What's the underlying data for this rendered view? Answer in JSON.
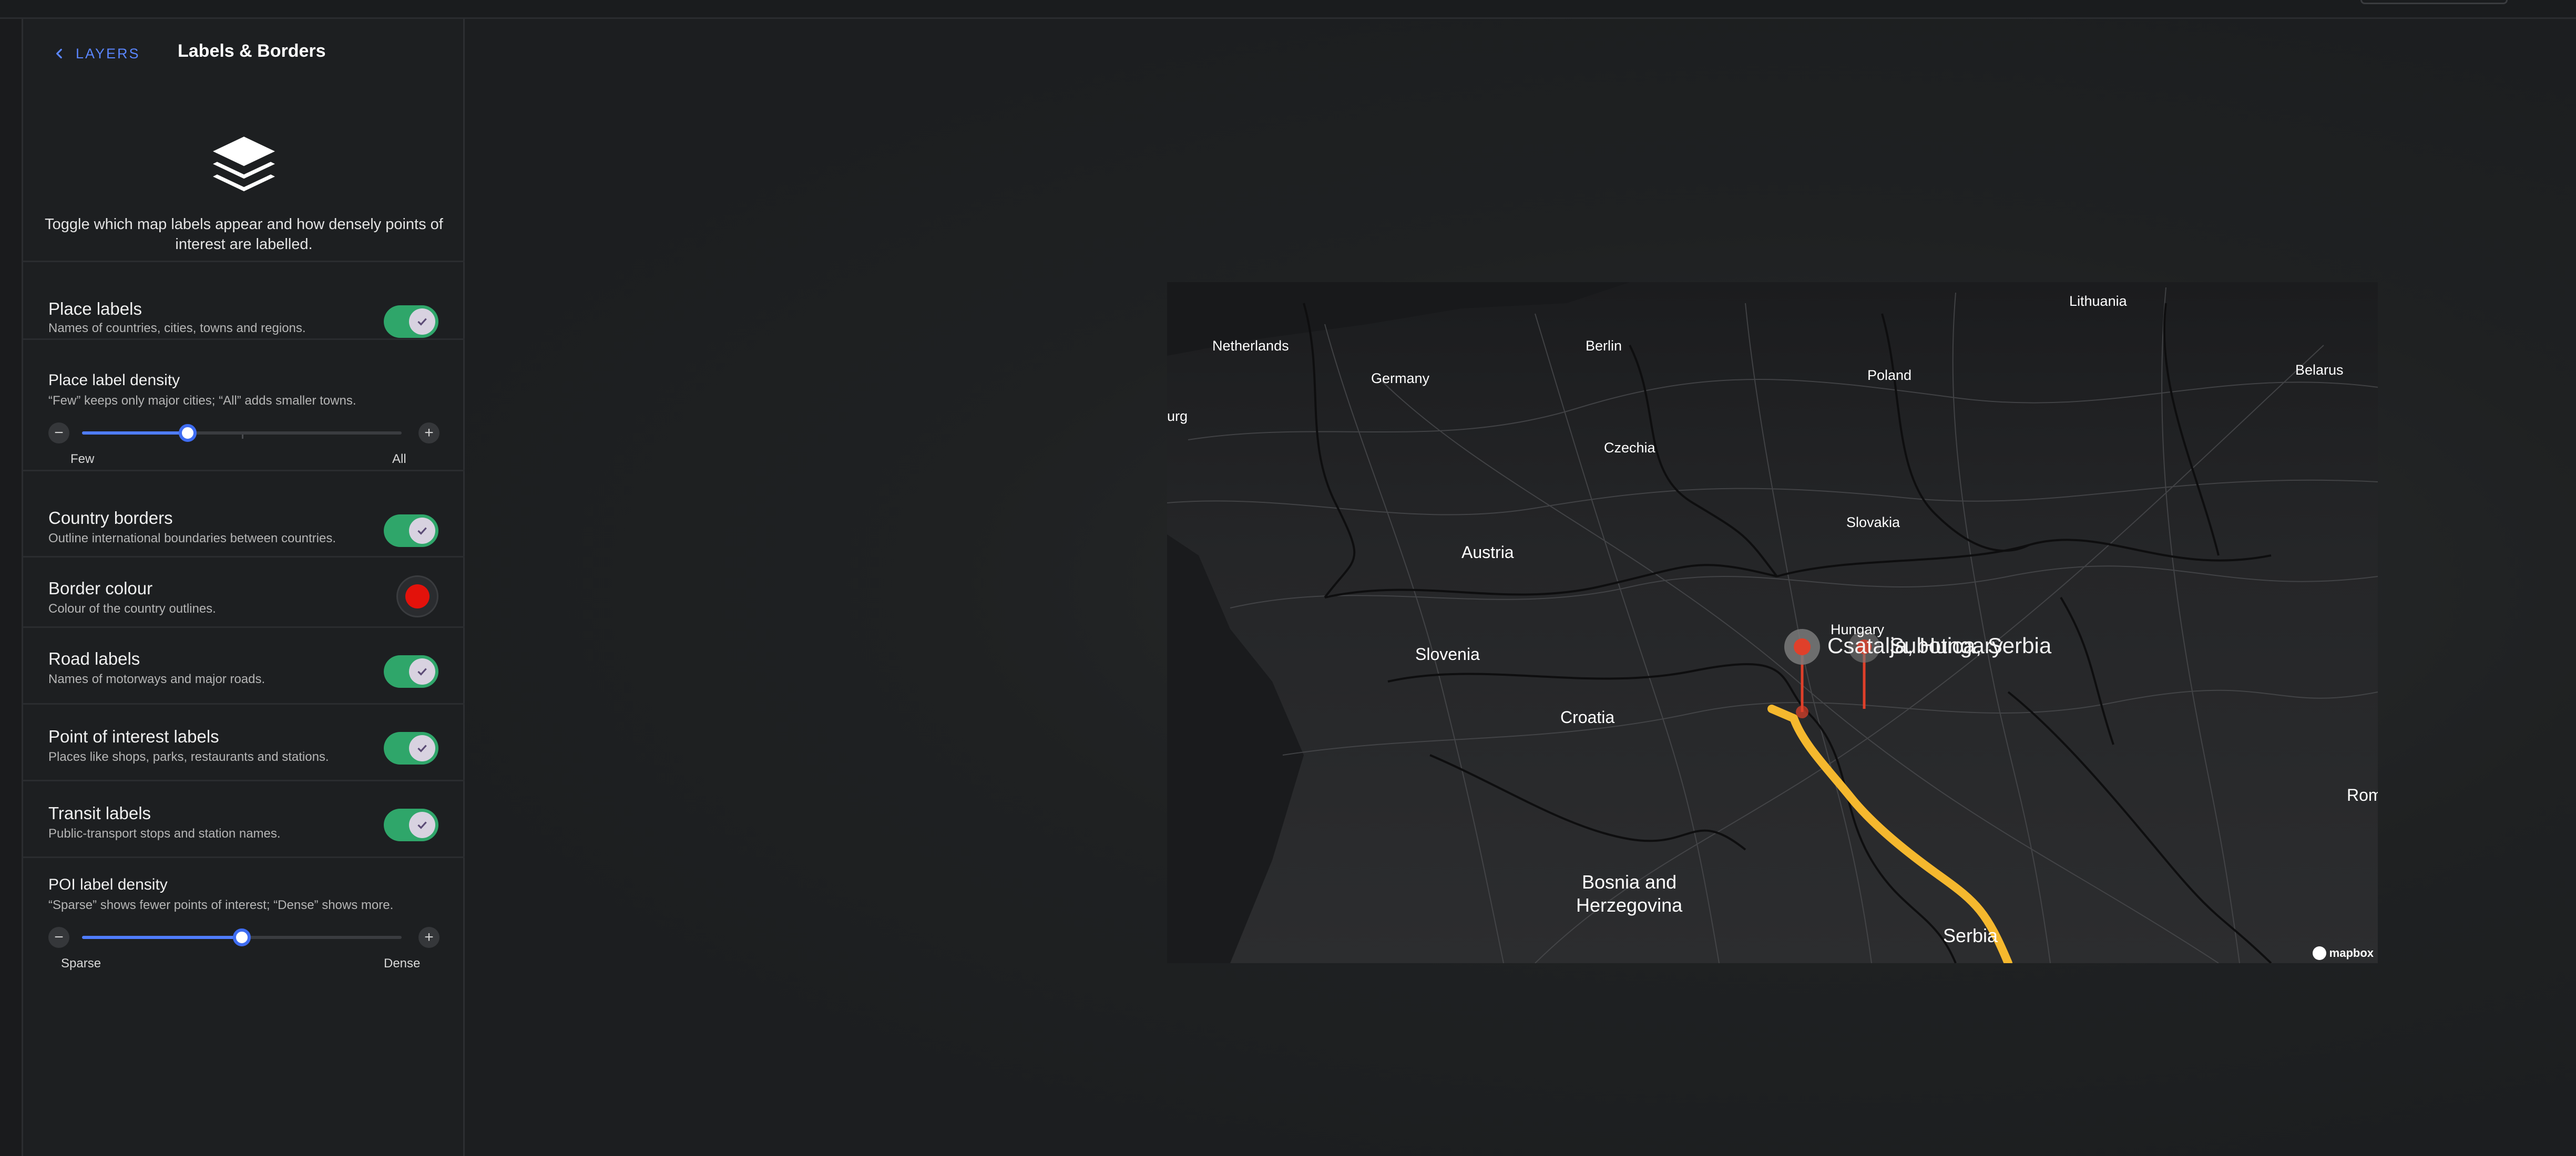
{
  "panel": {
    "back_label": "LAYERS",
    "title": "Labels & Borders",
    "intro": "Toggle which map labels appear and how densely points of interest are labelled."
  },
  "settings": {
    "place_labels": {
      "title": "Place labels",
      "desc": "Names of countries, cities, towns and regions.",
      "enabled": true
    },
    "place_density": {
      "title": "Place label density",
      "desc": "“Few” keeps only major cities; “All” adds smaller towns.",
      "min_label": "Few",
      "max_label": "All",
      "value": 0.33,
      "minus": "−",
      "plus": "+"
    },
    "country_borders": {
      "title": "Country borders",
      "desc": "Outline international boundaries between countries.",
      "enabled": true
    },
    "border_colour": {
      "title": "Border colour",
      "desc": "Colour of the country outlines.",
      "color": "#e3120b"
    },
    "road_labels": {
      "title": "Road labels",
      "desc": "Names of motorways and major roads.",
      "enabled": true
    },
    "poi_labels": {
      "title": "Point of interest labels",
      "desc": "Places like shops, parks, restaurants and stations.",
      "enabled": true
    },
    "transit_labels": {
      "title": "Transit labels",
      "desc": "Public-transport stops and station names.",
      "enabled": true
    },
    "poi_density": {
      "title": "POI label density",
      "desc": "“Sparse” shows fewer points of interest; “Dense” shows more.",
      "min_label": "Sparse",
      "max_label": "Dense",
      "value": 0.5,
      "minus": "−",
      "plus": "+"
    }
  },
  "map": {
    "labels": {
      "lithuania": "Lithuania",
      "netherlands": "Netherlands",
      "berlin": "Berlin",
      "germany": "Germany",
      "poland": "Poland",
      "belarus": "Belarus",
      "urg": "urg",
      "czechia": "Czechia",
      "slovakia": "Slovakia",
      "austria": "Austria",
      "hungary": "Hungary",
      "slovenia": "Slovenia",
      "croatia": "Croatia",
      "rom": "Rom",
      "bosnia": "Bosnia and\nHerzegovina",
      "serbia": "Serbia"
    },
    "markers": {
      "marker_1": "Csatalja, Hungary",
      "marker_2": "Subotica, Serbia"
    },
    "attribution": "mapbox",
    "route_color": "#f5b82e",
    "marker_color": "#e0402a"
  }
}
